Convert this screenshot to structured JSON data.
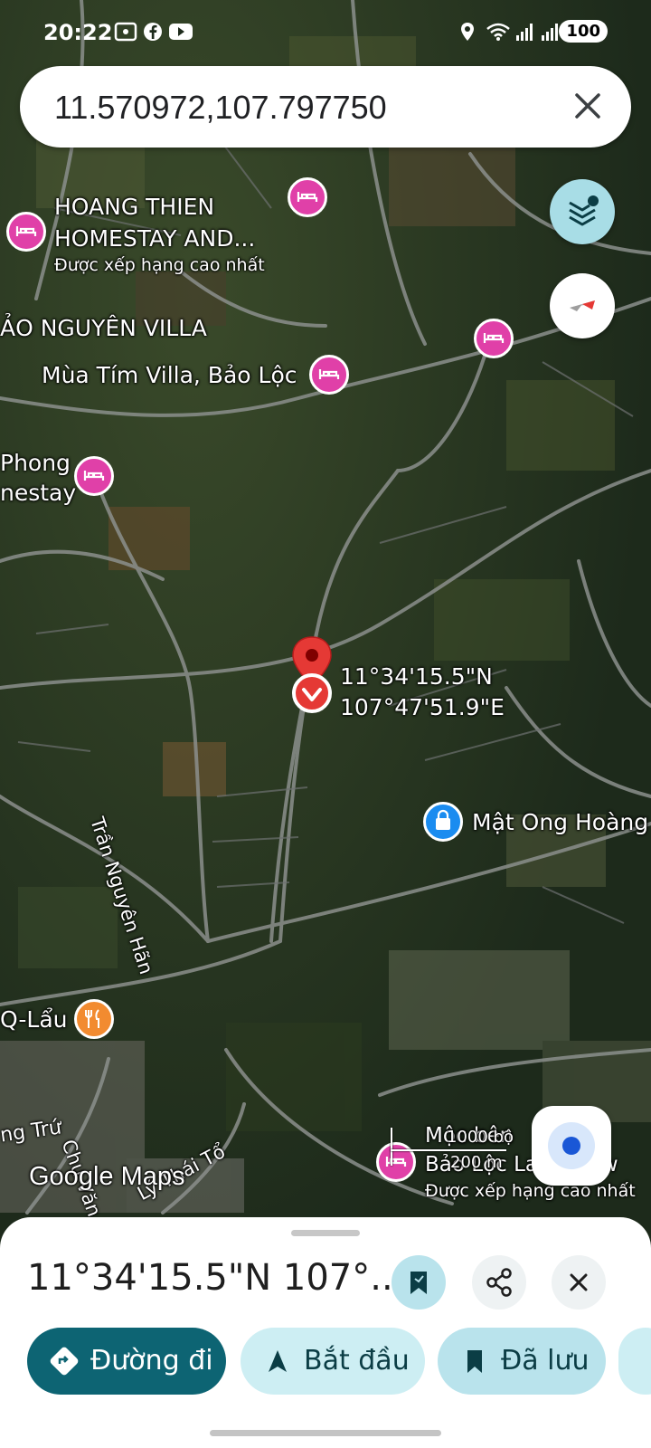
{
  "status_bar": {
    "time": "20:22",
    "battery": "100"
  },
  "search": {
    "query": "11.570972,107.797750"
  },
  "map": {
    "labels": {
      "hoang_thien_line1": "HOANG THIEN",
      "hoang_thien_line2": "HOMESTAY AND...",
      "hoang_thien_rating": "Được xếp hạng cao nhất",
      "bao_nguyen": "ẢO NGUYÊN VILLA",
      "mua_tim": "Mùa Tím Villa, Bảo Lộc",
      "phong_line1": "Phong",
      "phong_line2": "nestay",
      "pin_lat": "11°34'15.5\"N",
      "pin_lng": "107°47'51.9\"E",
      "mat_ong": "Mật Ong Hoàng",
      "tran_nguyen_han": "Trần Nguyên Hãn",
      "q_lau": "Q-Lẩu",
      "ng_tru": "ng Trứ",
      "chu_van_an": "Chu Văn An",
      "ly_thai_to": "Lý Thái Tổ",
      "bottom_poi_line1": "Mộc bên",
      "bottom_poi_line2": "Bảo Lộc Lake View",
      "bottom_poi_rating": "Được xếp hạng cao nhất",
      "google_maps": "Google Maps",
      "scale_feet": "1000 bộ",
      "scale_meters": "200 m"
    },
    "poi_colors": {
      "hotel": "#e040a8",
      "restaurant": "#f28b30",
      "shopping": "#1a8cf0",
      "pin": "#e53935"
    }
  },
  "sheet": {
    "title": "11°34'15.5\"N 107°...",
    "chips": {
      "directions": "Đường đi",
      "start": "Bắt đầu",
      "saved": "Đã lưu"
    }
  },
  "icons": {
    "layers": "layers-icon",
    "compass": "compass-icon",
    "location": "my-location-icon",
    "save": "bookmark-icon",
    "share": "share-icon",
    "close": "close-icon"
  }
}
